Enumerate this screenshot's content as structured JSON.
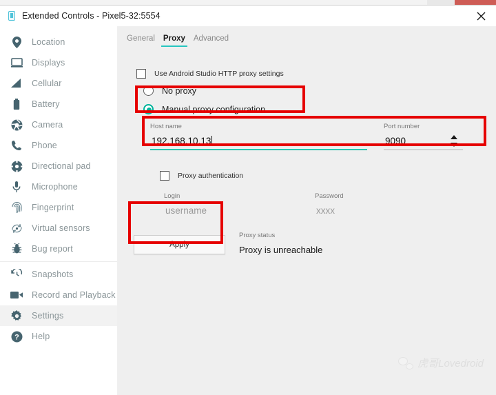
{
  "background_window": {
    "title_fragment": ""
  },
  "window": {
    "title": "Extended Controls - Pixel5-32:5554",
    "app_icon": "android-emulator-icon",
    "close_label": "✕"
  },
  "sidebar": {
    "items": [
      {
        "label": "Location",
        "icon": "location-pin-icon",
        "selected": false
      },
      {
        "label": "Displays",
        "icon": "monitor-icon",
        "selected": false
      },
      {
        "label": "Cellular",
        "icon": "signal-bars-icon",
        "selected": false
      },
      {
        "label": "Battery",
        "icon": "battery-icon",
        "selected": false
      },
      {
        "label": "Camera",
        "icon": "camera-shutter-icon",
        "selected": false
      },
      {
        "label": "Phone",
        "icon": "phone-handset-icon",
        "selected": false
      },
      {
        "label": "Directional pad",
        "icon": "dpad-icon",
        "selected": false
      },
      {
        "label": "Microphone",
        "icon": "microphone-icon",
        "selected": false
      },
      {
        "label": "Fingerprint",
        "icon": "fingerprint-icon",
        "selected": false
      },
      {
        "label": "Virtual sensors",
        "icon": "rotation-sensor-icon",
        "selected": false
      },
      {
        "label": "Bug report",
        "icon": "bug-icon",
        "selected": false
      },
      {
        "label": "Snapshots",
        "icon": "history-clock-icon",
        "selected": false,
        "separator_before": true
      },
      {
        "label": "Record and Playback",
        "icon": "video-camera-icon",
        "selected": false
      },
      {
        "label": "Settings",
        "icon": "gear-icon",
        "selected": true
      },
      {
        "label": "Help",
        "icon": "question-circle-icon",
        "selected": false
      }
    ]
  },
  "tabs": [
    {
      "label": "General",
      "active": false
    },
    {
      "label": "Proxy",
      "active": true
    },
    {
      "label": "Advanced",
      "active": false
    }
  ],
  "proxy": {
    "use_studio_checkbox": {
      "label": "Use Android Studio HTTP proxy settings",
      "checked": false
    },
    "radio_no_proxy": {
      "label": "No proxy",
      "selected": false
    },
    "radio_manual": {
      "label": "Manual proxy configuration",
      "selected": true
    },
    "host": {
      "label": "Host name",
      "value": "192.168.10.13",
      "focused": true
    },
    "port": {
      "label": "Port number",
      "value": "9090"
    },
    "auth_checkbox": {
      "label": "Proxy authentication",
      "checked": false
    },
    "login": {
      "label": "Login",
      "placeholder": "username"
    },
    "password": {
      "label": "Password",
      "placeholder": "xxxx"
    },
    "apply_label": "Apply",
    "status": {
      "label": "Proxy status",
      "value": "Proxy is unreachable"
    }
  },
  "watermark": {
    "text": "虎哥Lovedroid",
    "icon": "wechat-icon"
  },
  "colors": {
    "accent_teal": "#00b39b",
    "tab_underline": "#26c6c0",
    "annotation_red": "#e60000",
    "sidebar_text": "#8b9699",
    "content_bg": "#efefef"
  }
}
